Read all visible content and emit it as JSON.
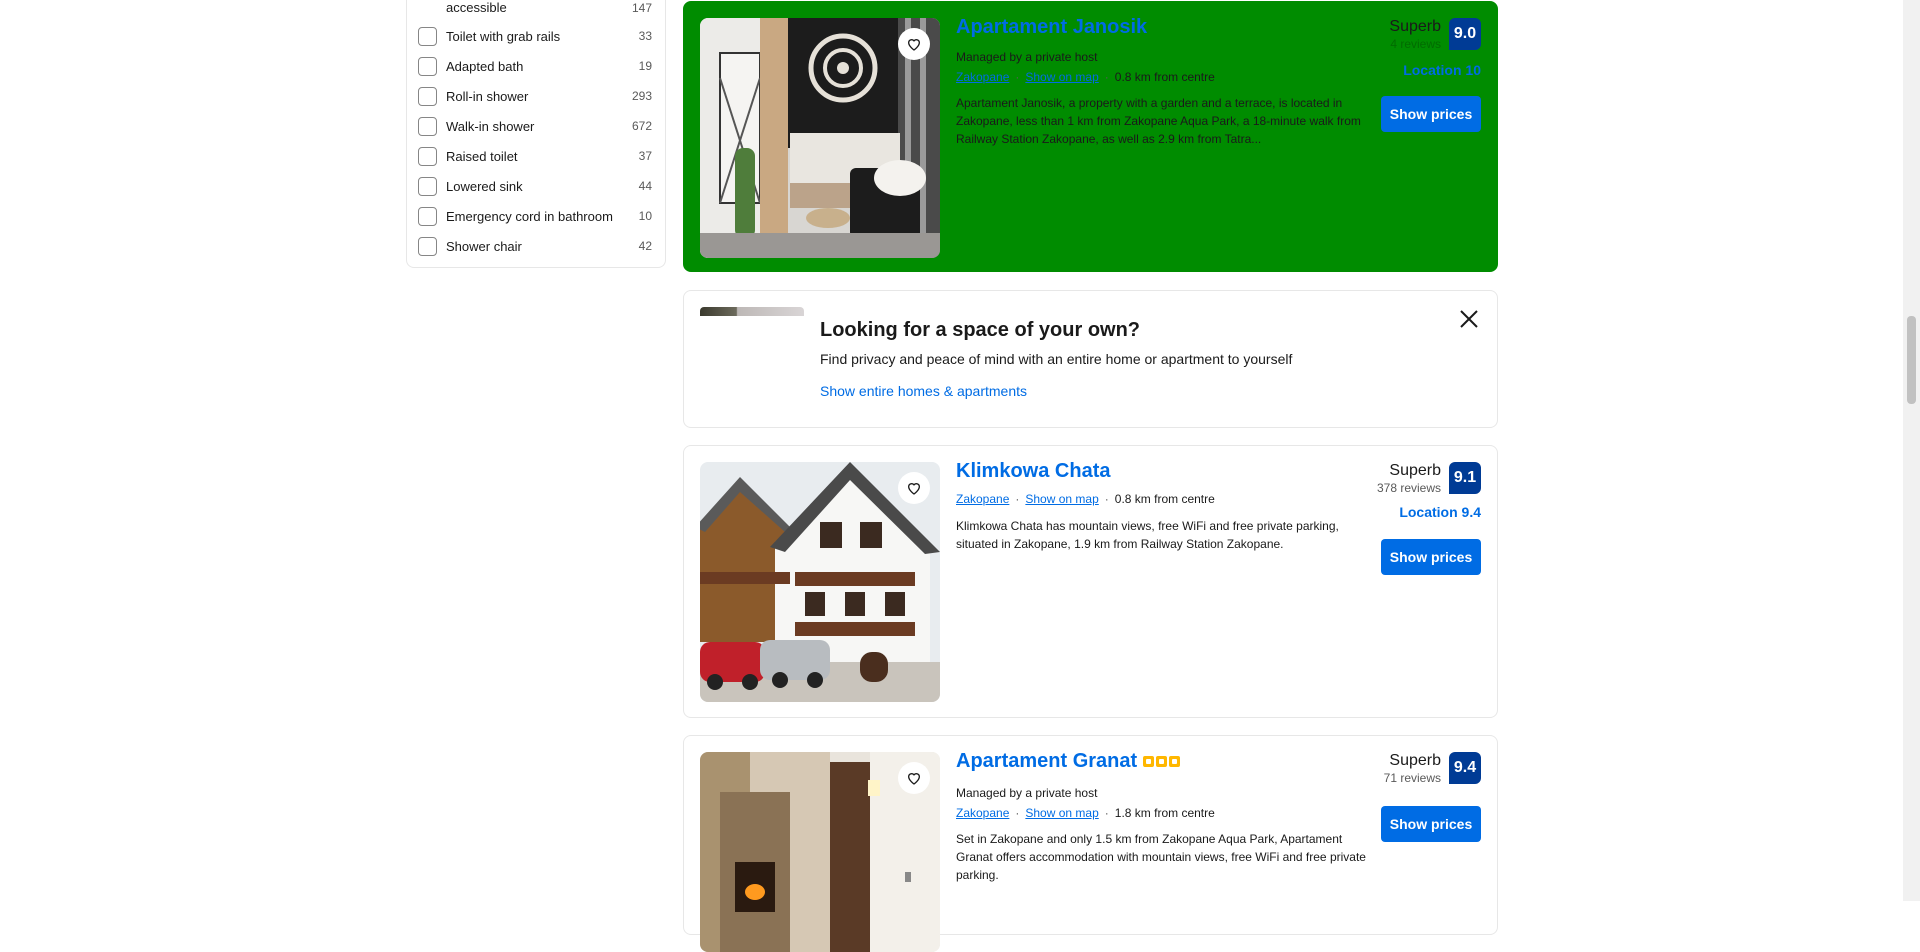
{
  "sidebar": {
    "top_partial": {
      "label": "accessible",
      "count": "147"
    },
    "filters": [
      {
        "label": "Toilet with grab rails",
        "count": "33"
      },
      {
        "label": "Adapted bath",
        "count": "19"
      },
      {
        "label": "Roll-in shower",
        "count": "293"
      },
      {
        "label": "Walk-in shower",
        "count": "672"
      },
      {
        "label": "Raised toilet",
        "count": "37"
      },
      {
        "label": "Lowered sink",
        "count": "44"
      },
      {
        "label": "Emergency cord in bathroom",
        "count": "10"
      },
      {
        "label": "Shower chair",
        "count": "42"
      }
    ]
  },
  "listings": [
    {
      "title": "Apartament Janosik",
      "host": "Managed by a private host",
      "city": "Zakopane",
      "map_link": "Show on map",
      "distance": "0.8 km from centre",
      "description": "Apartament Janosik, a property with a garden and a terrace, is located in Zakopane, less than 1 km from Zakopane Aqua Park, a 18-minute walk from Railway Station Zakopane, as well as 2.9 km from Tatra...",
      "score_word": "Superb",
      "reviews": "4 reviews",
      "score": "9.0",
      "location_score": "Location 10",
      "button": "Show prices"
    },
    {
      "title": "Klimkowa Chata",
      "city": "Zakopane",
      "map_link": "Show on map",
      "distance": "0.8 km from centre",
      "description": "Klimkowa Chata has mountain views, free WiFi and free private parking, situated in Zakopane, 1.9 km from Railway Station Zakopane.",
      "score_word": "Superb",
      "reviews": "378 reviews",
      "score": "9.1",
      "location_score": "Location 9.4",
      "button": "Show prices"
    },
    {
      "title": "Apartament Granat",
      "stars": 3,
      "host": "Managed by a private host",
      "city": "Zakopane",
      "map_link": "Show on map",
      "distance": "1.8 km from centre",
      "description": "Set in Zakopane and only 1.5 km from Zakopane Aqua Park, Apartament Granat offers accommodation with mountain views, free WiFi and free private parking.",
      "score_word": "Superb",
      "reviews": "71 reviews",
      "score": "9.4",
      "button": "Show prices"
    }
  ],
  "promo": {
    "title": "Looking for a space of your own?",
    "text": "Find privacy and peace of mind with an entire home or apartment to yourself",
    "link": "Show entire homes & apartments"
  },
  "colors": {
    "accent": "#006ce4",
    "score_badge": "#003b95",
    "highlight_bg": "#008c00",
    "star": "#ffb700"
  }
}
